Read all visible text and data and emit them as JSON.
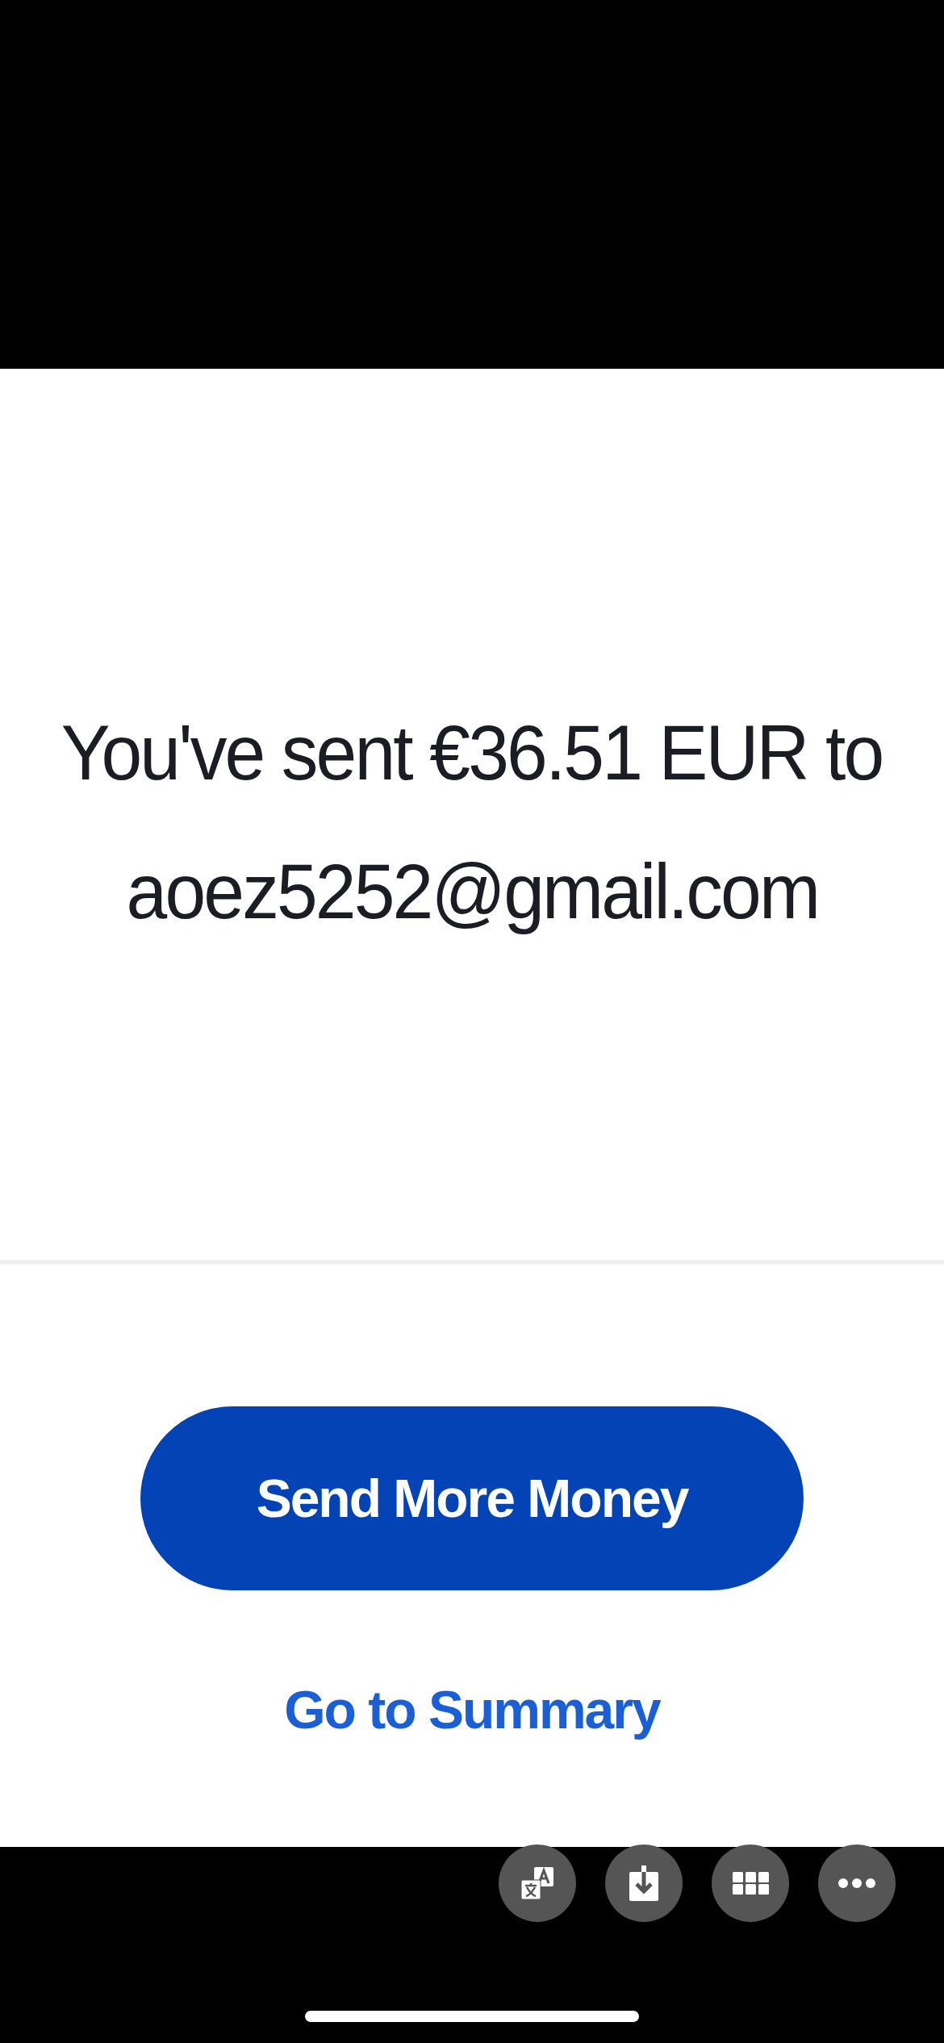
{
  "message": {
    "line_1": "You've sent €36.51 EUR to",
    "line_2": "aoez5252@gmail.com"
  },
  "primary_button": {
    "label": "Send More Money"
  },
  "secondary_link": {
    "label": "Go to Summary"
  },
  "viewer_toolbar": [
    {
      "kind": "translate"
    },
    {
      "kind": "download"
    },
    {
      "kind": "grid"
    },
    {
      "kind": "more"
    }
  ]
}
